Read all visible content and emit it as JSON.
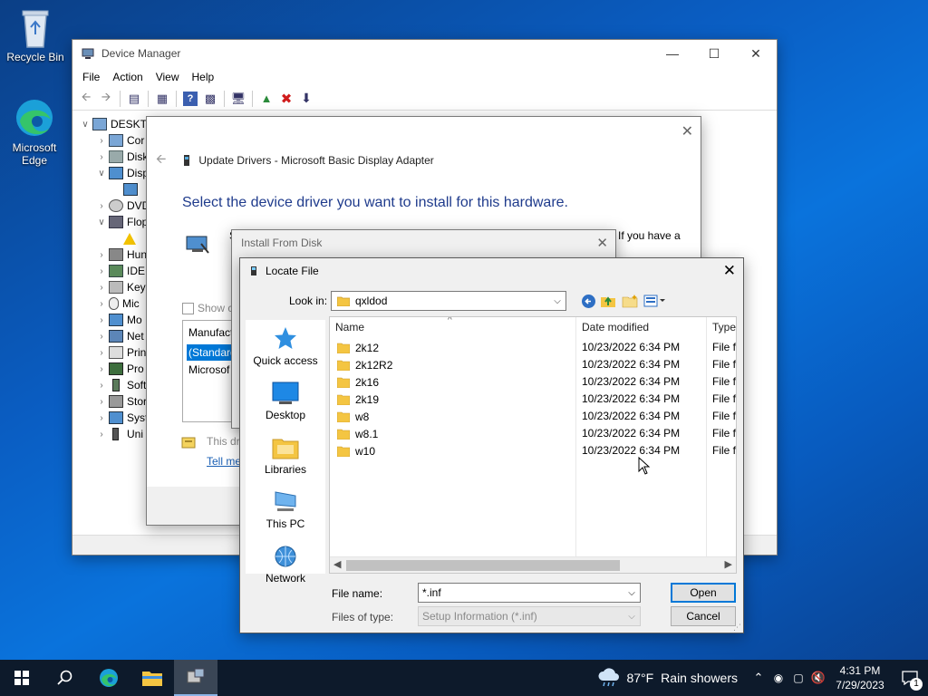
{
  "desktop": {
    "icons": [
      {
        "label": "Recycle Bin"
      },
      {
        "label": "Microsoft Edge"
      }
    ]
  },
  "device_manager": {
    "title": "Device Manager",
    "menu": [
      "File",
      "Action",
      "View",
      "Help"
    ],
    "tree": [
      "DESKTO",
      "Cor",
      "Disk",
      "Disp",
      "",
      "DVD",
      "Flop",
      "",
      "Hun",
      "IDE",
      "Key",
      "Mic",
      "Mo",
      "Net",
      "Prin",
      "Pro",
      "Soft",
      "Stor",
      "Syst",
      "Uni"
    ]
  },
  "update_drivers": {
    "title": "Update Drivers - Microsoft Basic Display Adapter",
    "headline": "Select the device driver you want to install for this hardware.",
    "right_text": "If you have a",
    "partial_s": "S",
    "show_compatible": "Show co",
    "list_header": "Manufact",
    "list_items": [
      "(Standard",
      "Microsof"
    ],
    "signed_text": "This dr",
    "tell_me": "Tell me"
  },
  "install_from_disk": {
    "title": "Install From Disk"
  },
  "locate_file": {
    "title": "Locate File",
    "look_in_label": "Look in:",
    "look_in_value": "qxldod",
    "places": [
      "Quick access",
      "Desktop",
      "Libraries",
      "This PC",
      "Network"
    ],
    "columns": {
      "name": "Name",
      "date": "Date modified",
      "type": "Type"
    },
    "files": [
      {
        "name": "2k12",
        "date": "10/23/2022 6:34 PM",
        "type": "File fo"
      },
      {
        "name": "2k12R2",
        "date": "10/23/2022 6:34 PM",
        "type": "File fo"
      },
      {
        "name": "2k16",
        "date": "10/23/2022 6:34 PM",
        "type": "File fo"
      },
      {
        "name": "2k19",
        "date": "10/23/2022 6:34 PM",
        "type": "File fo"
      },
      {
        "name": "w8",
        "date": "10/23/2022 6:34 PM",
        "type": "File fo"
      },
      {
        "name": "w8.1",
        "date": "10/23/2022 6:34 PM",
        "type": "File fo"
      },
      {
        "name": "w10",
        "date": "10/23/2022 6:34 PM",
        "type": "File fo"
      }
    ],
    "file_name_label": "File name:",
    "file_name_value": "*.inf",
    "files_of_type_label": "Files of type:",
    "files_of_type_value": "Setup Information (*.inf)",
    "open_label": "Open",
    "cancel_label": "Cancel"
  },
  "taskbar": {
    "weather_temp": "87°F",
    "weather_text": "Rain showers",
    "time": "4:31 PM",
    "date": "7/29/2023",
    "notification_count": "1"
  },
  "colors": {
    "accent": "#0078d7",
    "folder": "#f4c542",
    "headline": "#1f3b8c"
  }
}
